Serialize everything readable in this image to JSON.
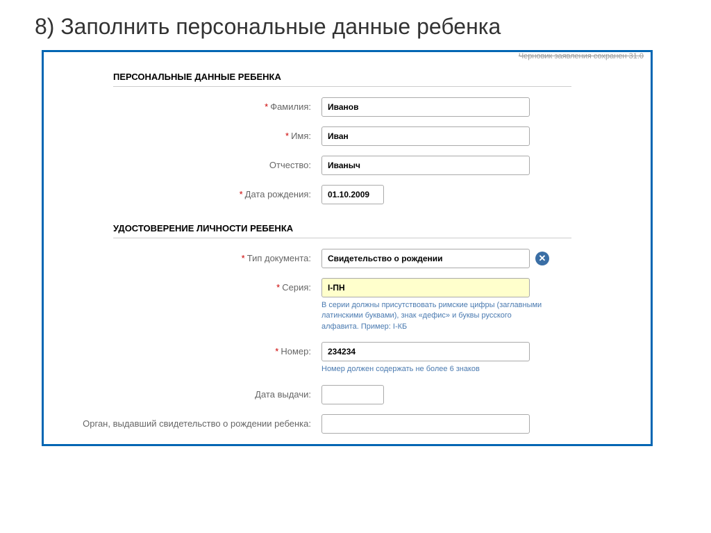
{
  "slide": {
    "title": "8) Заполнить персональные данные ребенка"
  },
  "draft_note": "Черновик заявления сохранен 31.0",
  "sections": {
    "personal": {
      "header": "ПЕРСОНАЛЬНЫЕ ДАННЫЕ РЕБЕНКА",
      "fields": {
        "surname": {
          "label": "Фамилия:",
          "value": "Иванов"
        },
        "name": {
          "label": "Имя:",
          "value": "Иван"
        },
        "patronymic": {
          "label": "Отчество:",
          "value": "Иваныч"
        },
        "birthdate": {
          "label": "Дата рождения:",
          "value": "01.10.2009"
        }
      }
    },
    "identity": {
      "header": "УДОСТОВЕРЕНИЕ ЛИЧНОСТИ РЕБЕНКА",
      "fields": {
        "doctype": {
          "label": "Тип документа:",
          "value": "Свидетельство о рождении"
        },
        "series": {
          "label": "Серия:",
          "value": "I-ПН",
          "hint": "В серии должны присутствовать римские цифры (заглавными латинскими буквами), знак «дефис» и буквы русского алфавита. Пример: I-КБ"
        },
        "number": {
          "label": "Номер:",
          "value": "234234",
          "hint": "Номер должен содержать не более 6 знаков"
        },
        "issue_date": {
          "label": "Дата выдачи:",
          "value": ""
        },
        "issuer": {
          "label": "Орган, выдавший свидетельство о рождении ребенка:",
          "value": ""
        }
      }
    }
  },
  "required_marker": "*"
}
